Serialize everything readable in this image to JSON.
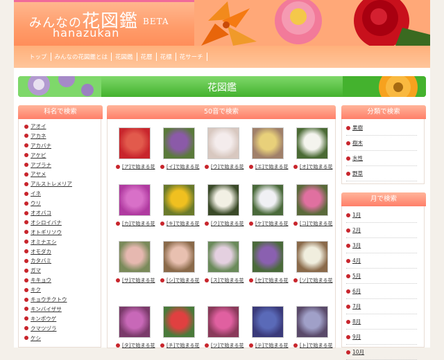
{
  "header": {
    "logo_jp_prefix": "みんなの",
    "logo_jp_big": "花図鑑",
    "logo_beta": "BETA",
    "logo_en": "hanazukan"
  },
  "nav": [
    "トップ",
    "みんなの花図鑑とは",
    "花図鑑",
    "花暦",
    "花標",
    "花サーチ"
  ],
  "banner_title": "花図鑑",
  "left_panel": {
    "title": "科名で検索",
    "items": [
      "アオイ",
      "アカネ",
      "アカバナ",
      "アケビ",
      "アブラナ",
      "アヤメ",
      "アルストレメリア",
      "イネ",
      "ウリ",
      "オオバコ",
      "オシロイバナ",
      "オトギリソウ",
      "オミナエシ",
      "オモダカ",
      "カタバミ",
      "ガマ",
      "キキョウ",
      "キク",
      "キョウチクトウ",
      "キンバイザサ",
      "キンポウゲ",
      "クマツヅラ",
      "ケシ"
    ]
  },
  "center_panel": {
    "title": "50音で検索",
    "items": [
      {
        "label": "[ア]で始まる花",
        "color": "#c8252c",
        "accent": "#e25a4c"
      },
      {
        "label": "[イ]で始まる花",
        "color": "#5a7a3a",
        "accent": "#8b5aa8"
      },
      {
        "label": "[ウ]で始まる花",
        "color": "#d8c8c0",
        "accent": "#f4ecec"
      },
      {
        "label": "[エ]で始まる花",
        "color": "#a0806a",
        "accent": "#e8d07a"
      },
      {
        "label": "[オ]で始まる花",
        "color": "#4a6a34",
        "accent": "#f4f4ee"
      },
      {
        "label": "[カ]で始まる花",
        "color": "#b03aa0",
        "accent": "#d870c8"
      },
      {
        "label": "[キ]で始まる花",
        "color": "#6a7a2a",
        "accent": "#f0c020"
      },
      {
        "label": "[ク]で始まる花",
        "color": "#3a4a28",
        "accent": "#f2f0e4"
      },
      {
        "label": "[ケ]で始まる花",
        "color": "#4a6a3a",
        "accent": "#f0f0f4"
      },
      {
        "label": "[コ]で始まる花",
        "color": "#5a6a3a",
        "accent": "#e070a0"
      },
      {
        "label": "[サ]で始まる花",
        "color": "#7a8a5a",
        "accent": "#e6b8b0"
      },
      {
        "label": "[シ]で始まる花",
        "color": "#8a6a4a",
        "accent": "#e8c0b0"
      },
      {
        "label": "[ス]で始まる花",
        "color": "#6a8a5a",
        "accent": "#e4d0e0"
      },
      {
        "label": "[セ]で始まる花",
        "color": "#4a6a3a",
        "accent": "#8a60b0"
      },
      {
        "label": "[ソ]で始まる花",
        "color": "#8a6a4a",
        "accent": "#f0eede"
      },
      {
        "label": "[タ]で始まる花",
        "color": "#7a3a6a",
        "accent": "#c868b8"
      },
      {
        "label": "[チ]で始まる花",
        "color": "#4a7a3a",
        "accent": "#e04040"
      },
      {
        "label": "[ツ]で始まる花",
        "color": "#8a3a5a",
        "accent": "#e060a0"
      },
      {
        "label": "[テ]で始まる花",
        "color": "#3a3a7a",
        "accent": "#5a6ab8"
      },
      {
        "label": "[ト]で始まる花",
        "color": "#5a4a6a",
        "accent": "#a0a0c8"
      }
    ]
  },
  "right_panel_1": {
    "title": "分類で検索",
    "items": [
      "果樹",
      "樹木",
      "水性",
      "野草"
    ]
  },
  "right_panel_2": {
    "title": "月で検索",
    "items": [
      "1月",
      "2月",
      "3月",
      "4月",
      "5月",
      "6月",
      "7月",
      "8月",
      "9月",
      "10月"
    ]
  },
  "colors": {
    "header_orange": "#ff9c6a",
    "banner_green": "#44b22e",
    "panel_head": "#ff7f69",
    "bullet_red": "#c8252c"
  }
}
